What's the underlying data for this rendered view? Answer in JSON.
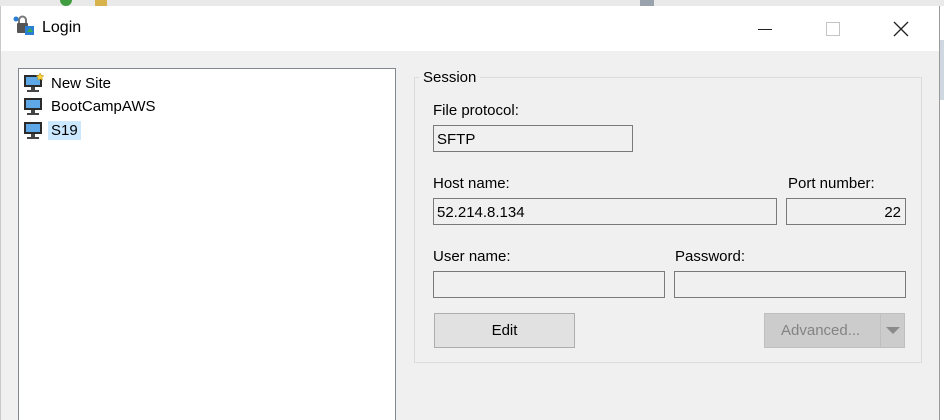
{
  "window": {
    "title": "Login"
  },
  "sites": [
    {
      "label": "New Site",
      "icon": "new-site-icon"
    },
    {
      "label": "BootCampAWS",
      "icon": "computer-icon"
    },
    {
      "label": "S19",
      "icon": "computer-icon",
      "selected": true
    }
  ],
  "session": {
    "legend": "Session",
    "file_protocol_label": "File protocol:",
    "file_protocol_value": "SFTP",
    "host_name_label": "Host name:",
    "host_name_value": "52.214.8.134",
    "port_number_label": "Port number:",
    "port_number_value": "22",
    "user_name_label": "User name:",
    "user_name_value": "",
    "password_label": "Password:",
    "password_value": "",
    "edit_label": "Edit",
    "advanced_label": "Advanced..."
  },
  "colors": {
    "selection": "#cce8ff",
    "panel": "#f0f0f0",
    "border": "#7a7a7a"
  }
}
